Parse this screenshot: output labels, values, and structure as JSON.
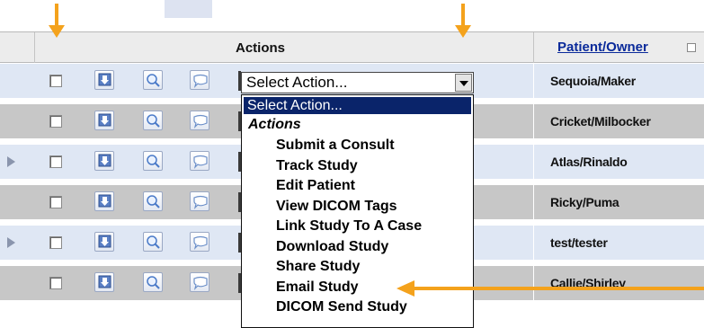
{
  "header": {
    "actions_label": "Actions",
    "patient_label": "Patient/Owner"
  },
  "rows": [
    {
      "patient": "Sequoia/Maker",
      "expand": false
    },
    {
      "patient": "Cricket/Milbocker",
      "expand": false
    },
    {
      "patient": "Atlas/Rinaldo",
      "expand": true
    },
    {
      "patient": "Ricky/Puma",
      "expand": false
    },
    {
      "patient": "test/tester",
      "expand": true
    },
    {
      "patient": "Callie/Shirley",
      "expand": false
    }
  ],
  "select": {
    "value": "Select Action...",
    "options_selected": "Select Action...",
    "group_label": "Actions",
    "items": [
      "Submit a Consult",
      "Track Study",
      "Edit Patient",
      "View DICOM Tags",
      "Link Study To A Case",
      "Download Study",
      "Share Study",
      "Email Study",
      "DICOM Send Study"
    ]
  },
  "colors": {
    "annotation_arrow": "#f4a21c",
    "highlight": "#0a246a"
  },
  "icons": [
    "download-icon",
    "magnifier-icon",
    "speech-bubble-icon",
    "expand-arrow-icon"
  ]
}
